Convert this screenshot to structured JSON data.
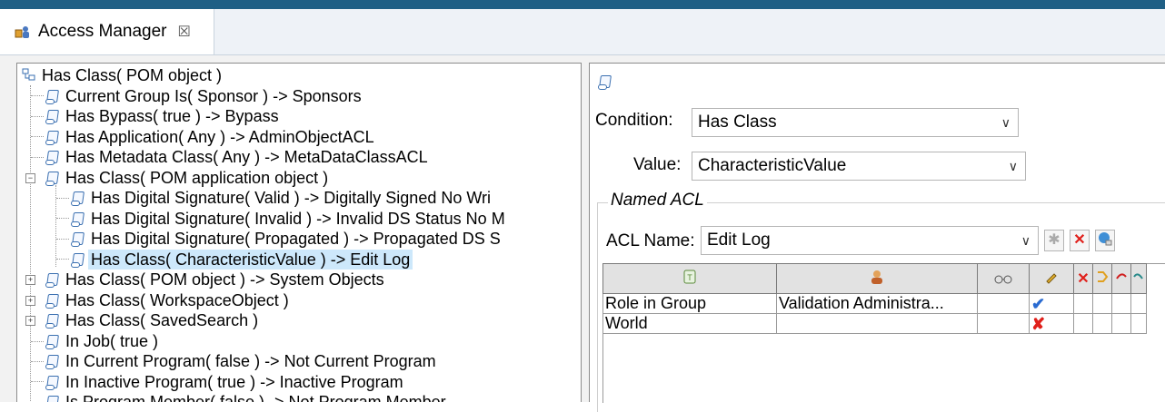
{
  "tab": {
    "title": "Access Manager",
    "close": "☒"
  },
  "tree": {
    "rows": [
      {
        "label": "Has Class( POM object )"
      },
      {
        "label": "Current Group Is( Sponsor ) -> Sponsors"
      },
      {
        "label": "Has Bypass( true ) -> Bypass"
      },
      {
        "label": "Has Application( Any ) -> AdminObjectACL"
      },
      {
        "label": "Has Metadata Class( Any ) -> MetaDataClassACL"
      },
      {
        "label": "Has Class( POM application object )"
      },
      {
        "label": "Has Digital Signature( Valid ) -> Digitally Signed No Wri"
      },
      {
        "label": "Has Digital Signature( Invalid ) -> Invalid DS Status No M"
      },
      {
        "label": "Has Digital Signature( Propagated ) -> Propagated DS S"
      },
      {
        "label": "Has Class( CharacteristicValue ) -> Edit Log"
      },
      {
        "label": "Has Class( POM object ) -> System Objects"
      },
      {
        "label": "Has Class( WorkspaceObject )"
      },
      {
        "label": "Has Class( SavedSearch )"
      },
      {
        "label": "In Job( true )"
      },
      {
        "label": "In Current Program( false ) -> Not Current Program"
      },
      {
        "label": "In Inactive Program( true ) -> Inactive Program"
      },
      {
        "label": "Is Program Member( false ) -> Not Program Member"
      }
    ]
  },
  "details": {
    "condition_label": "Condition:",
    "condition_value": "Has Class",
    "value_label": "Value:",
    "value_value": "CharacteristicValue",
    "named_acl_title": "Named ACL",
    "acl_name_label": "ACL Name:",
    "acl_name_value": "Edit Log"
  },
  "acl_table": {
    "rows": [
      {
        "type": "Role in Group",
        "id": "Validation Administra...",
        "mark": "✔",
        "mark_color": "#2a6bd1"
      },
      {
        "type": "World",
        "id": "",
        "mark": "✘",
        "mark_color": "#e0201b"
      }
    ]
  },
  "colors": {
    "accent": "#1f5f85",
    "selection": "#cde8fb"
  }
}
